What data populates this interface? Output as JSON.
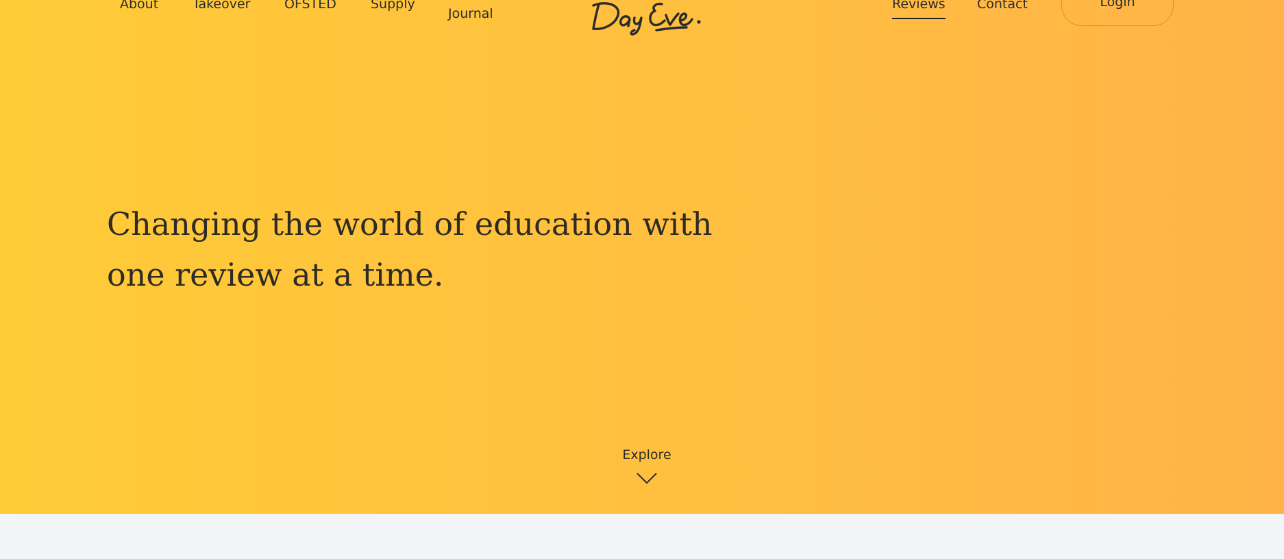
{
  "nav": {
    "left_items": [
      {
        "label": "About"
      },
      {
        "label": "Takeover"
      },
      {
        "label": "OFSTED"
      },
      {
        "label": "Supply"
      },
      {
        "label": "Journal"
      }
    ],
    "logo_text": "Day Eve.",
    "right_items": [
      {
        "label": "Reviews",
        "active": true
      },
      {
        "label": "Contact"
      }
    ],
    "login_label": "Login"
  },
  "hero": {
    "headline": "Changing the world of education with one review at a time.",
    "explore_label": "Explore",
    "explore_icon": "chevron-down-icon"
  },
  "colors": {
    "gradient_start": "#ffcb37",
    "gradient_end": "#ffb347",
    "text": "#2b2b2b",
    "lower_background": "#f3f4f6"
  }
}
